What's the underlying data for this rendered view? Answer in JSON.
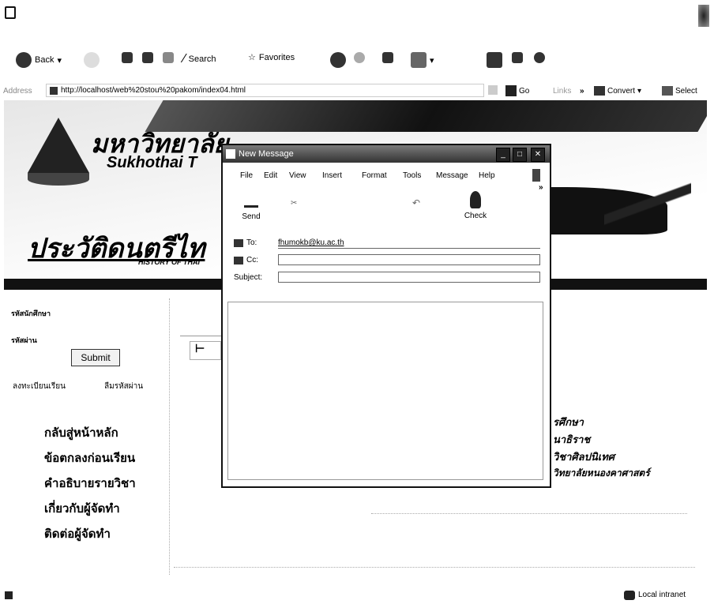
{
  "toolbar": {
    "back_label": "Back",
    "search_label": "Search",
    "favorites_label": "Favorites"
  },
  "address_bar": {
    "label": "Address",
    "url": "http://localhost/web%20stou%20pakom/index04.html",
    "go_label": "Go",
    "links_label": "Links",
    "convert_label": "Convert",
    "select_label": "Select"
  },
  "banner": {
    "university_thai": "มหาวิทยาลัย",
    "university_en": "Sukhothai T",
    "heading_thai": "ประวัติดนตรีไท",
    "heading_en": "HISTORY OF THAI"
  },
  "sidebar": {
    "username_label": "รหัสนักศึกษา",
    "password_label": "รหัสผ่าน",
    "submit_label": "Submit",
    "register_link": "ลงทะเบียนเรียน",
    "forgot_link": "ลืมรหัสผ่าน",
    "menu": [
      {
        "label": "กลับสู่หน้าหลัก"
      },
      {
        "label": "ข้อตกลงก่อนเรียน"
      },
      {
        "label": "คำอธิบายรายวิชา"
      },
      {
        "label": "เกี่ยวกับผู้จัดทำ"
      },
      {
        "label": "ติดต่อผู้จัดทำ"
      }
    ]
  },
  "content": {
    "item_1": "รศึกษา",
    "item_2": "นาธิราช",
    "item_3": "วิชาศิลปนิเทศ",
    "item_4": "วิทยาลัยหนองคาศาสตร์"
  },
  "new_message": {
    "title": "New Message",
    "menu": [
      "File",
      "Edit",
      "View",
      "Insert",
      "Format",
      "Tools",
      "Message",
      "Help"
    ],
    "send_label": "Send",
    "check_label": "Check",
    "to_label": "To:",
    "to_value": "fhumokb@ku.ac.th",
    "cc_label": "Cc:",
    "cc_value": "",
    "subject_label": "Subject:",
    "subject_value": ""
  },
  "status_bar": {
    "zone": "Local intranet"
  }
}
